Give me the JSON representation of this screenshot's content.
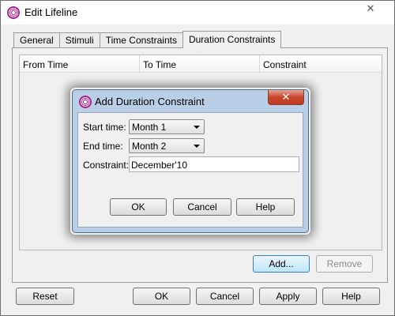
{
  "window": {
    "title": "Edit Lifeline",
    "close_glyph": "✕",
    "icon": "app-logo-icon"
  },
  "tabs": [
    {
      "label": "General",
      "active": false
    },
    {
      "label": "Stimuli",
      "active": false
    },
    {
      "label": "Time Constraints",
      "active": false
    },
    {
      "label": "Duration Constraints",
      "active": true
    }
  ],
  "table": {
    "columns": [
      "From Time",
      "To Time",
      "Constraint"
    ],
    "rows": []
  },
  "panel_buttons": {
    "add": "Add...",
    "remove": "Remove"
  },
  "footer": {
    "reset": "Reset",
    "ok": "OK",
    "cancel": "Cancel",
    "apply": "Apply",
    "help": "Help"
  },
  "dialog": {
    "title": "Add Duration Constraint",
    "close_glyph": "✕",
    "start_label": "Start time:",
    "start_value": "Month 1",
    "end_label": "End time:",
    "end_value": "Month 2",
    "constraint_label": "Constraint:",
    "constraint_value": "December'10",
    "ok": "OK",
    "cancel": "Cancel",
    "help": "Help"
  },
  "colors": {
    "focus_accent": "#3c7fb1",
    "dialog_frame": "#b9cfe6",
    "close_red": "#c7452d"
  }
}
